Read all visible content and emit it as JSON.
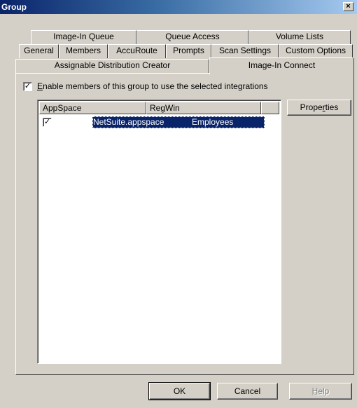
{
  "window": {
    "title": "Group",
    "close_glyph": "×"
  },
  "tabs": {
    "row1": [
      {
        "label": "Image-In Queue"
      },
      {
        "label": "Queue Access"
      },
      {
        "label": "Volume Lists"
      }
    ],
    "row2": [
      {
        "label": "General"
      },
      {
        "label": "Members"
      },
      {
        "label": "AccuRoute"
      },
      {
        "label": "Prompts"
      },
      {
        "label": "Scan Settings"
      },
      {
        "label": "Custom Options"
      }
    ],
    "row3": [
      {
        "label": "Assignable Distribution Creator"
      },
      {
        "label": "Image-In Connect",
        "active": true
      }
    ]
  },
  "enable_checkbox": {
    "checked": true,
    "check_glyph": "✓",
    "label_mnemonic": "E",
    "label_rest": "nable members of this group to use the selected integrations"
  },
  "list": {
    "columns": [
      "AppSpace",
      "RegWin"
    ],
    "rows": [
      {
        "checked": true,
        "appspace": "NetSuite.appspace",
        "regwin": "Employees",
        "selected": true
      }
    ]
  },
  "properties_button": {
    "label_pre": "Prope",
    "label_mnemonic": "r",
    "label_post": "ties"
  },
  "footer": {
    "ok": "OK",
    "cancel": "Cancel",
    "help_mnemonic": "H",
    "help_rest": "elp"
  }
}
